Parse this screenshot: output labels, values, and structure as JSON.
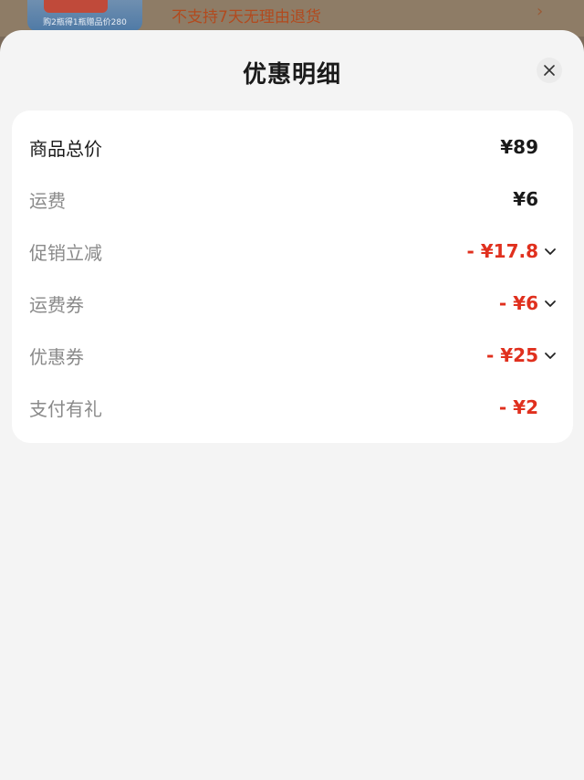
{
  "background": {
    "thumb_caption": "购2瓶得1瓶赠品价280",
    "notice_text": "不支持7天无理由退货",
    "chevron": "›"
  },
  "sheet": {
    "title": "优惠明细",
    "close_icon": "close-icon"
  },
  "rows": [
    {
      "label": "商品总价",
      "value": "¥89",
      "type": "primary",
      "expandable": false
    },
    {
      "label": "运费",
      "value": "¥6",
      "type": "normal",
      "expandable": false
    },
    {
      "label": "促销立减",
      "value": "- ¥17.8",
      "type": "discount",
      "expandable": true
    },
    {
      "label": "运费券",
      "value": "- ¥6",
      "type": "discount",
      "expandable": true
    },
    {
      "label": "优惠券",
      "value": "- ¥25",
      "type": "discount",
      "expandable": true
    },
    {
      "label": "支付有礼",
      "value": "- ¥2",
      "type": "discount",
      "expandable": false
    }
  ],
  "colors": {
    "discount": "#e0301e",
    "sheet_bg": "#f4f4f4",
    "card_bg": "#ffffff"
  }
}
